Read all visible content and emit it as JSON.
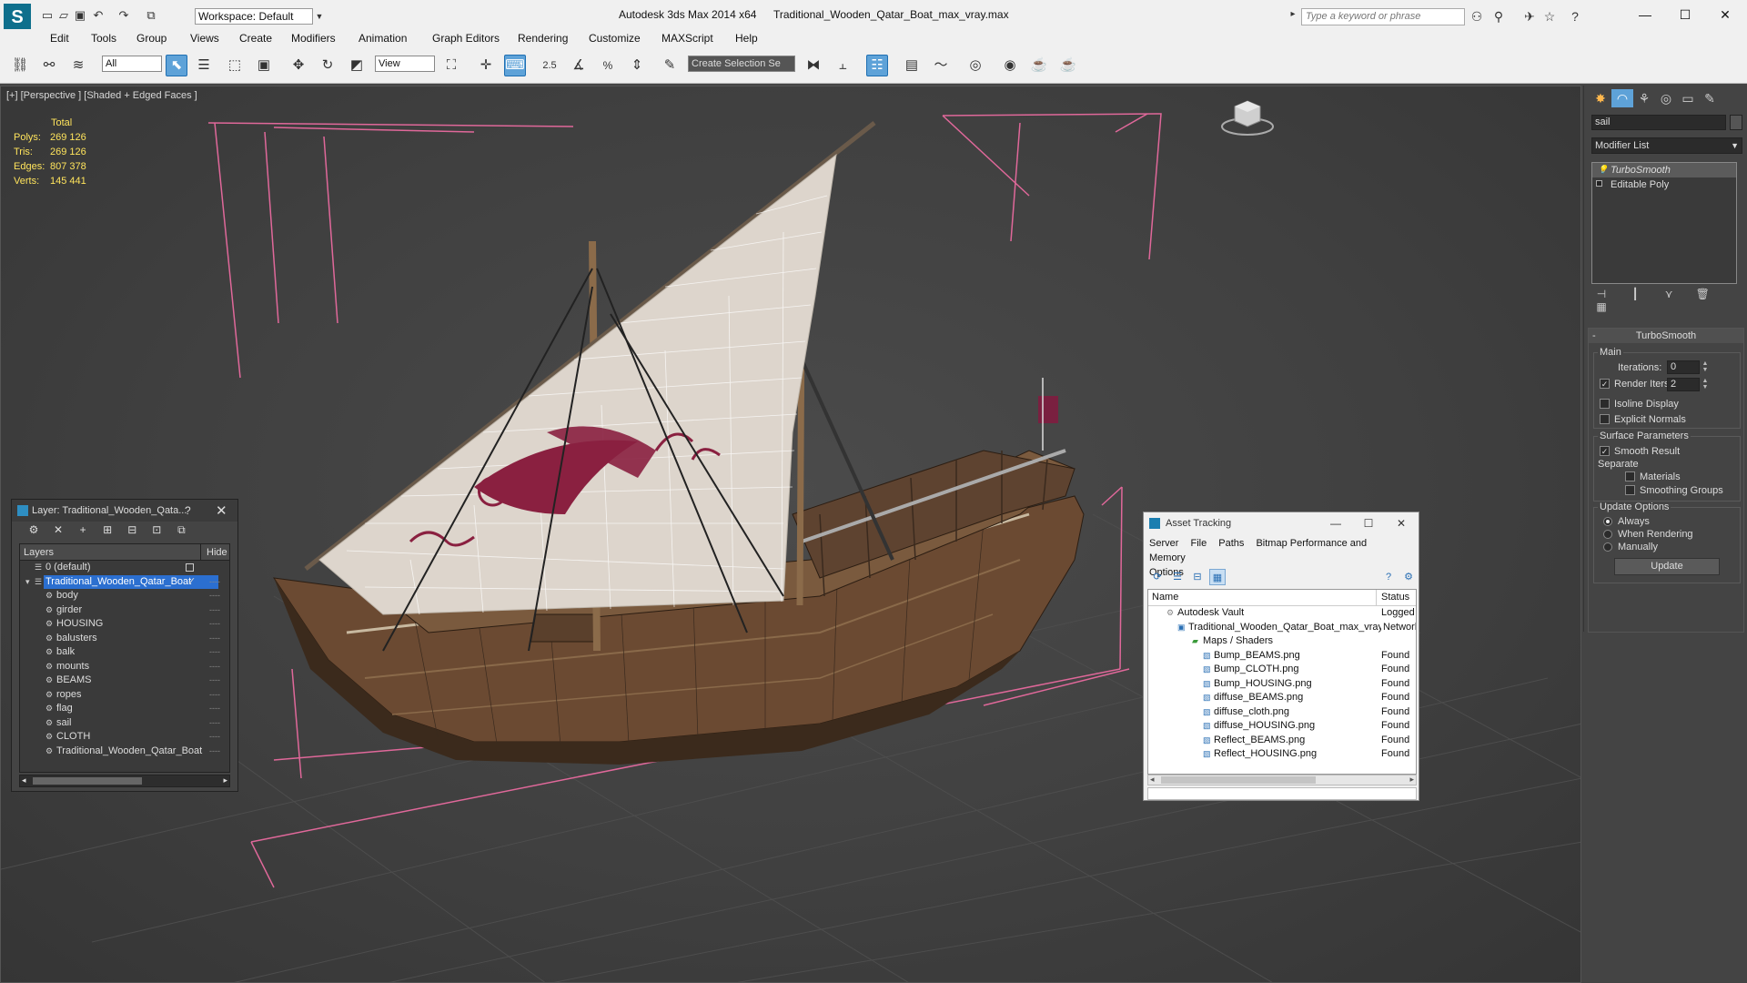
{
  "titlebar": {
    "app_title": "Autodesk 3ds Max  2014 x64",
    "doc_title": "Traditional_Wooden_Qatar_Boat_max_vray.max",
    "workspace": "Workspace: Default",
    "search_placeholder": "Type a keyword or phrase"
  },
  "menu": [
    "Edit",
    "Tools",
    "Group",
    "Views",
    "Create",
    "Modifiers",
    "Animation",
    "Graph Editors",
    "Rendering",
    "Customize",
    "MAXScript",
    "Help"
  ],
  "toolbar": {
    "filter": "All",
    "coord_system": "View",
    "selection_set": "Create Selection Se"
  },
  "viewport": {
    "label": "[+] [Perspective ] [Shaded + Edged Faces ]",
    "stats": {
      "header": "Total",
      "rows": [
        {
          "k": "Polys:",
          "v": "269 126"
        },
        {
          "k": "Tris:",
          "v": "269 126"
        },
        {
          "k": "Edges:",
          "v": "807 378"
        },
        {
          "k": "Verts:",
          "v": "145 441"
        }
      ]
    }
  },
  "command_panel": {
    "object_name": "sail",
    "modifier_list": "Modifier List",
    "stack": [
      "TurboSmooth",
      "Editable Poly"
    ],
    "rollout_title": "TurboSmooth",
    "main_label": "Main",
    "iterations_label": "Iterations:",
    "iterations_value": "0",
    "render_iters_label": "Render Iters:",
    "render_iters_value": "2",
    "isoline_label": "Isoline Display",
    "explicit_normals_label": "Explicit Normals",
    "surface_params_label": "Surface Parameters",
    "smooth_result_label": "Smooth Result",
    "separate_label": "Separate",
    "materials_label": "Materials",
    "smoothing_groups_label": "Smoothing Groups",
    "update_options_label": "Update Options",
    "always_label": "Always",
    "when_rendering_label": "When Rendering",
    "manually_label": "Manually",
    "update_button": "Update"
  },
  "layer_window": {
    "title": "Layer: Traditional_Wooden_Qata...",
    "help": "?",
    "col_layers": "Layers",
    "col_hide": "Hide",
    "rows": [
      {
        "name": "0 (default)",
        "level": 0
      },
      {
        "name": "Traditional_Wooden_Qatar_Boat",
        "level": 0,
        "selected": true
      },
      {
        "name": "body",
        "level": 1
      },
      {
        "name": "girder",
        "level": 1
      },
      {
        "name": "HOUSING",
        "level": 1
      },
      {
        "name": "balusters",
        "level": 1
      },
      {
        "name": "balk",
        "level": 1
      },
      {
        "name": "mounts",
        "level": 1
      },
      {
        "name": "BEAMS",
        "level": 1
      },
      {
        "name": "ropes",
        "level": 1
      },
      {
        "name": "flag",
        "level": 1
      },
      {
        "name": "sail",
        "level": 1
      },
      {
        "name": "CLOTH",
        "level": 1
      },
      {
        "name": "Traditional_Wooden_Qatar_Boat",
        "level": 1
      }
    ]
  },
  "asset_tracking": {
    "title": "Asset Tracking",
    "menu": [
      "Server",
      "File",
      "Paths",
      "Bitmap Performance and Memory",
      "Options"
    ],
    "col_name": "Name",
    "col_status": "Status",
    "rows": [
      {
        "name": "Autodesk Vault",
        "status": "Logged O",
        "level": 0
      },
      {
        "name": "Traditional_Wooden_Qatar_Boat_max_vray.max",
        "status": "Network",
        "level": 1
      },
      {
        "name": "Maps / Shaders",
        "status": "",
        "level": 2
      },
      {
        "name": "Bump_BEAMS.png",
        "status": "Found",
        "level": 3
      },
      {
        "name": "Bump_CLOTH.png",
        "status": "Found",
        "level": 3
      },
      {
        "name": "Bump_HOUSING.png",
        "status": "Found",
        "level": 3
      },
      {
        "name": "diffuse_BEAMS.png",
        "status": "Found",
        "level": 3
      },
      {
        "name": "diffuse_cloth.png",
        "status": "Found",
        "level": 3
      },
      {
        "name": "diffuse_HOUSING.png",
        "status": "Found",
        "level": 3
      },
      {
        "name": "Reflect_BEAMS.png",
        "status": "Found",
        "level": 3
      },
      {
        "name": "Reflect_HOUSING.png",
        "status": "Found",
        "level": 3
      }
    ]
  },
  "colors": {
    "stats_text": "#ffe45c",
    "selection_blue": "#2b6fd0",
    "bbox_pink": "#e0689a",
    "sail_print": "#8a2040"
  }
}
